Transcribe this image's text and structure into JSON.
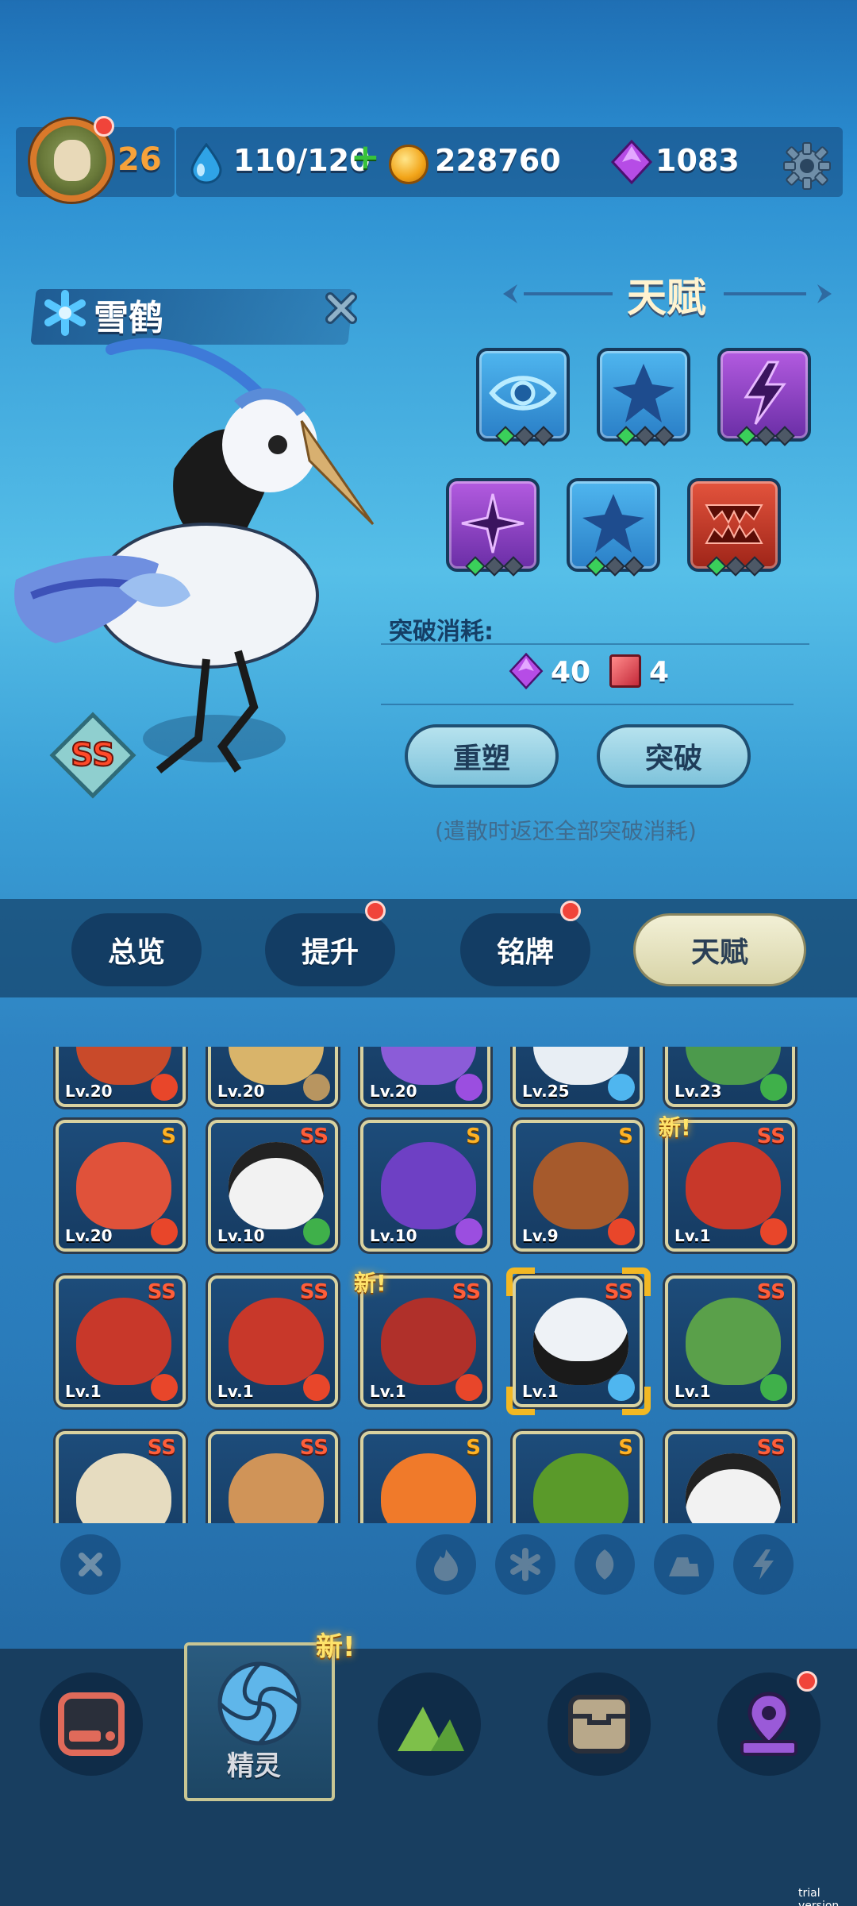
{
  "header": {
    "player_level": "26",
    "energy": "110/120",
    "coins": "228760",
    "gems": "1083"
  },
  "creature": {
    "name": "雪鹤",
    "rank": "SS"
  },
  "talent": {
    "title": "天赋",
    "slots": [
      {
        "icon": "eye-icon",
        "color": "blue",
        "level": 1
      },
      {
        "icon": "spike-ball-icon",
        "color": "blue",
        "level": 1
      },
      {
        "icon": "lightning-icon",
        "color": "purple",
        "level": 1
      },
      {
        "icon": "shuriken-icon",
        "color": "purple",
        "level": 1
      },
      {
        "icon": "spike-ball-icon",
        "color": "blue",
        "level": 1
      },
      {
        "icon": "fang-icon",
        "color": "red",
        "level": 1
      }
    ],
    "breakthrough_label": "突破消耗:",
    "cost_gem": "40",
    "cost_book": "4",
    "reset_button": "重塑",
    "breakthrough_button": "突破",
    "reset_note": "(遣散时返还全部突破消耗)"
  },
  "tabs": [
    {
      "label": "总览",
      "badge": false
    },
    {
      "label": "提升",
      "badge": true
    },
    {
      "label": "铭牌",
      "badge": true
    },
    {
      "label": "天赋",
      "badge": false,
      "active": true
    }
  ],
  "grid": {
    "row0": [
      {
        "level": "Lv.20",
        "element": "fire"
      },
      {
        "level": "Lv.20",
        "element": "earth"
      },
      {
        "level": "Lv.20",
        "element": "lightning"
      },
      {
        "level": "Lv.25",
        "element": "ice"
      },
      {
        "level": "Lv.23",
        "element": "leaf"
      }
    ],
    "row1": [
      {
        "level": "Lv.20",
        "rank": "S",
        "element": "fire"
      },
      {
        "level": "Lv.10",
        "rank": "SS",
        "element": "leaf"
      },
      {
        "level": "Lv.10",
        "rank": "S",
        "element": "lightning"
      },
      {
        "level": "Lv.9",
        "rank": "S",
        "element": "fire"
      },
      {
        "level": "Lv.1",
        "rank": "SS",
        "element": "fire",
        "new": "新!"
      }
    ],
    "row2": [
      {
        "level": "Lv.1",
        "rank": "SS",
        "element": "fire"
      },
      {
        "level": "Lv.1",
        "rank": "SS",
        "element": "fire"
      },
      {
        "level": "Lv.1",
        "rank": "SS",
        "element": "fire",
        "new": "新!"
      },
      {
        "level": "Lv.1",
        "rank": "SS",
        "element": "ice",
        "selected": true
      },
      {
        "level": "Lv.1",
        "rank": "SS",
        "element": "leaf"
      }
    ],
    "row3": [
      {
        "rank": "SS"
      },
      {
        "rank": "SS"
      },
      {
        "rank": "S"
      },
      {
        "rank": "S"
      },
      {
        "rank": "SS"
      }
    ]
  },
  "filters": [
    "close-filter-icon",
    "fire-filter-icon",
    "ice-filter-icon",
    "leaf-filter-icon",
    "earth-filter-icon",
    "lightning-filter-icon"
  ],
  "bottom_nav": {
    "items": [
      "shop-icon",
      "spirit-icon",
      "adventure-icon",
      "inventory-icon",
      "map-icon"
    ],
    "active_label": "精灵",
    "new_tag": "新!"
  },
  "watermark": "trial version",
  "colors": {
    "fire": "#e8462a",
    "ice": "#4fb6ef",
    "leaf": "#3fb04a",
    "lightning": "#9b4ee0",
    "earth": "#b89560"
  }
}
